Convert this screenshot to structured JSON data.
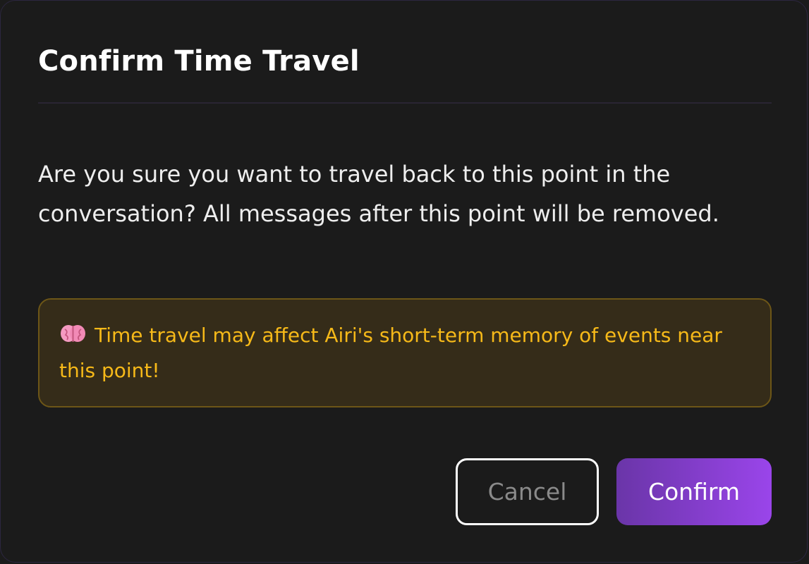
{
  "dialog": {
    "title": "Confirm Time Travel",
    "message": "Are you sure you want to travel back to this point in the conversation? All messages after this point will be removed.",
    "warning": {
      "icon": "brain-icon",
      "text": "Time travel may affect Airi's short-term memory of events near this point!"
    },
    "buttons": {
      "cancel_label": "Cancel",
      "confirm_label": "Confirm"
    }
  },
  "colors": {
    "background": "#1b1b1b",
    "warning_text": "#f6b919",
    "warning_bg": "#352c19",
    "confirm_gradient_start": "#6a35a8",
    "confirm_gradient_end": "#9a45ea"
  }
}
